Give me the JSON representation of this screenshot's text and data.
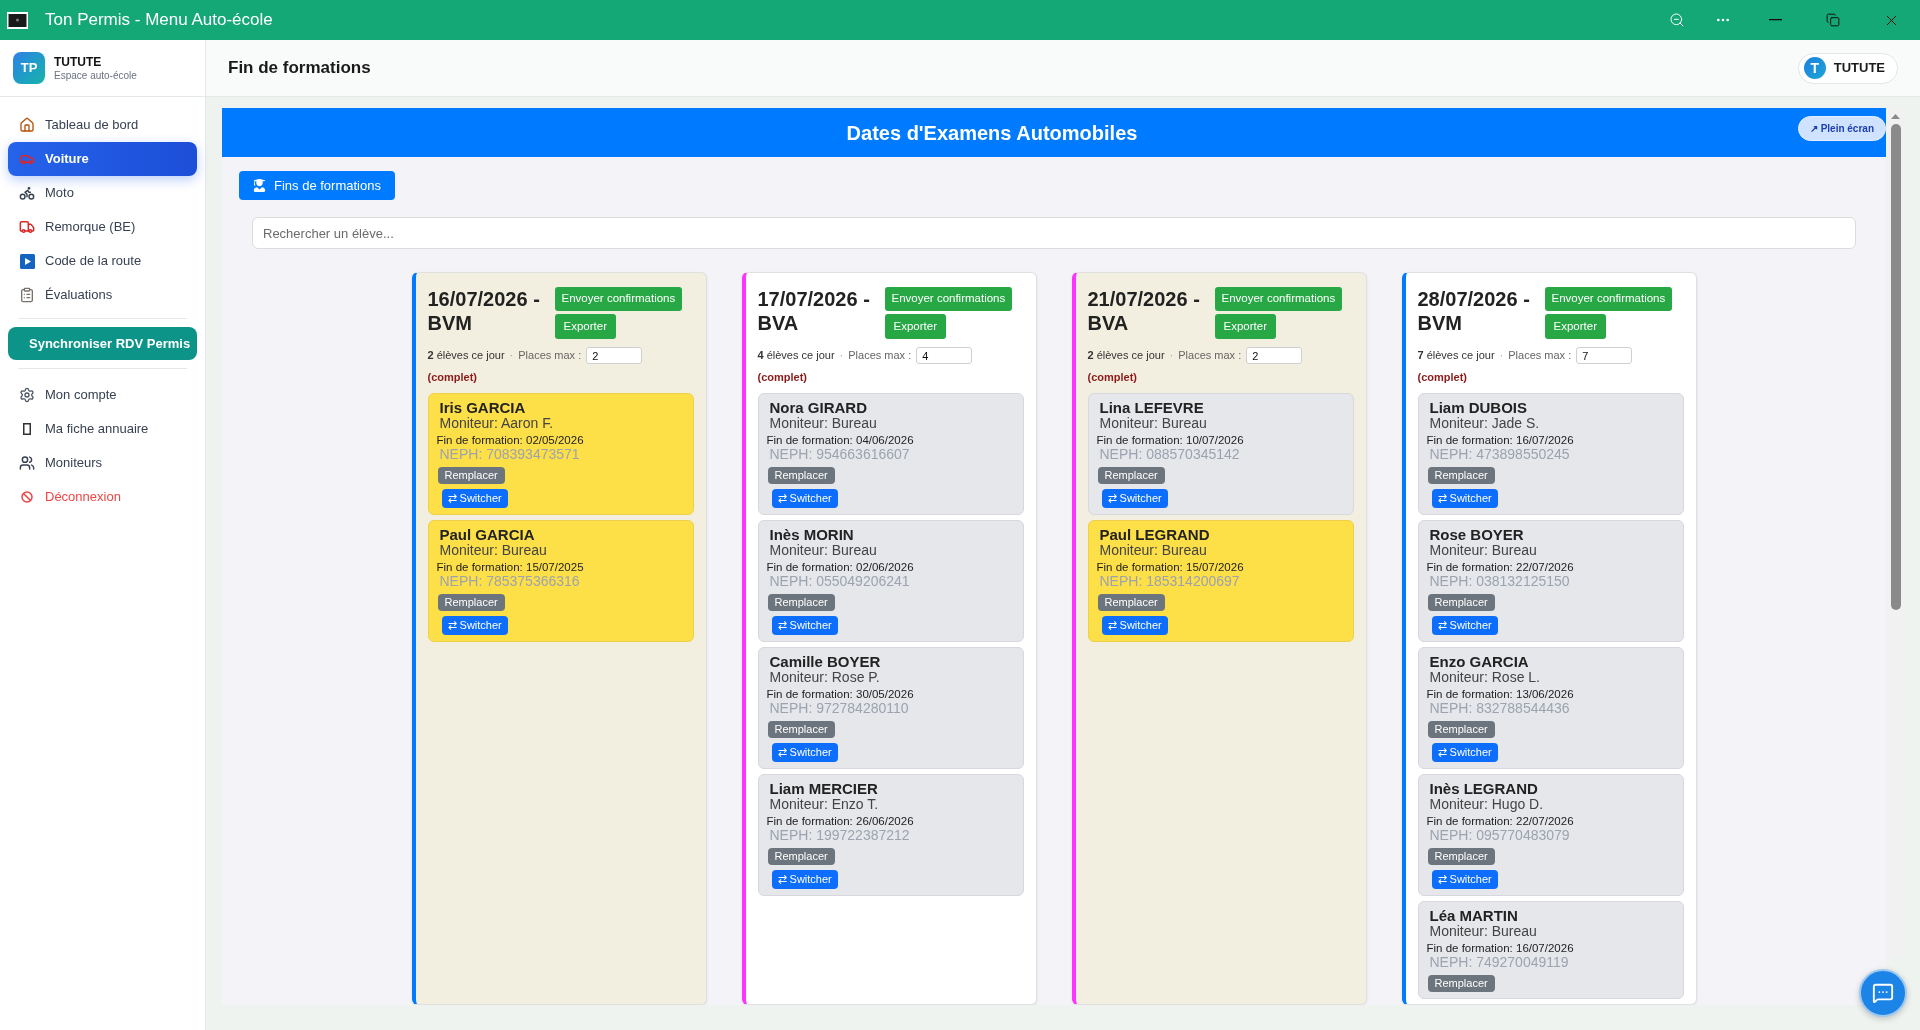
{
  "window": {
    "title": "Ton Permis - Menu Auto-école"
  },
  "sidebar": {
    "brand": {
      "logo": "TP",
      "name": "TUTUTE",
      "subtitle": "Espace auto-école"
    },
    "nav_items": [
      {
        "label": "Tableau de bord",
        "selected": false
      },
      {
        "label": "Voiture",
        "selected": true
      },
      {
        "label": "Moto",
        "selected": false
      },
      {
        "label": "Remorque (BE)",
        "selected": false
      },
      {
        "label": "Code de la route",
        "selected": false
      },
      {
        "label": "Évaluations",
        "selected": false
      }
    ],
    "sync_button": {
      "label": "Synchroniser RDV Permis"
    },
    "account_items": [
      {
        "label": "Mon compte",
        "kind": "link",
        "selected": false
      },
      {
        "label": "Ma fiche annuaire",
        "kind": "link",
        "selected": false
      },
      {
        "label": "Moniteurs",
        "kind": "link",
        "selected": false
      },
      {
        "label": "Déconnexion",
        "kind": "danger",
        "selected": false
      }
    ]
  },
  "header": {
    "title": "Fin de formations",
    "user": {
      "initial": "T",
      "name": "TUTUTE"
    }
  },
  "panel": {
    "title": "Dates d'Examens Automobiles",
    "fullscreen_button": "↗ Plein écran",
    "filter_button": "Fins de formations",
    "search": {
      "placeholder": "Rechercher un élève..."
    },
    "columns": [
      {
        "title": "16/07/2026 - BVM",
        "color": "#007bff",
        "confirm_button": "Envoyer confirmations",
        "export_button": "Exporter",
        "count": "**2** élèves ce jour",
        "separator": "·",
        "places_label": "Places max :",
        "places_value": "2",
        "status": "(complet)",
        "students": [
          {
            "name": "Iris GARCIA",
            "monitor": "Moniteur: Aaron F.",
            "end_date": "Fin de formation: 02/05/2026",
            "neph": "NEPH: 708393473571",
            "highlighted": true,
            "replace_button": "Remplacer",
            "switch_button": "⇄ Switcher"
          },
          {
            "name": "Paul GARCIA",
            "monitor": "Moniteur: Bureau",
            "end_date": "Fin de formation: 15/07/2025",
            "neph": "NEPH: 785375366316",
            "highlighted": true,
            "replace_button": "Remplacer",
            "switch_button": "⇄ Switcher"
          }
        ]
      },
      {
        "title": "17/07/2026 - BVA",
        "color": "#ff33ff",
        "confirm_button": "Envoyer confirmations",
        "export_button": "Exporter",
        "count": "**4** élèves ce jour",
        "separator": "·",
        "places_label": "Places max :",
        "places_value": "4",
        "status": "(complet)",
        "students": [
          {
            "name": "Nora GIRARD",
            "monitor": "Moniteur: Bureau",
            "end_date": "Fin de formation: 04/06/2026",
            "neph": "NEPH: 954663616607",
            "highlighted": false,
            "replace_button": "Remplacer",
            "switch_button": "⇄ Switcher"
          },
          {
            "name": "Inès MORIN",
            "monitor": "Moniteur: Bureau",
            "end_date": "Fin de formation: 02/06/2026",
            "neph": "NEPH: 055049206241",
            "highlighted": false,
            "replace_button": "Remplacer",
            "switch_button": "⇄ Switcher"
          },
          {
            "name": "Camille BOYER",
            "monitor": "Moniteur: Rose P.",
            "end_date": "Fin de formation: 30/05/2026",
            "neph": "NEPH: 972784280110",
            "highlighted": false,
            "replace_button": "Remplacer",
            "switch_button": "⇄ Switcher"
          },
          {
            "name": "Liam MERCIER",
            "monitor": "Moniteur: Enzo T.",
            "end_date": "Fin de formation: 26/06/2026",
            "neph": "NEPH: 199722387212",
            "highlighted": false,
            "replace_button": "Remplacer",
            "switch_button": "⇄ Switcher"
          }
        ]
      },
      {
        "title": "21/07/2026 - BVA",
        "color": "#ff33ff",
        "confirm_button": "Envoyer confirmations",
        "export_button": "Exporter",
        "count": "**2** élèves ce jour",
        "separator": "·",
        "places_label": "Places max :",
        "places_value": "2",
        "status": "(complet)",
        "students": [
          {
            "name": "Lina LEFEVRE",
            "monitor": "Moniteur: Bureau",
            "end_date": "Fin de formation: 10/07/2026",
            "neph": "NEPH: 088570345142",
            "highlighted": false,
            "replace_button": "Remplacer",
            "switch_button": "⇄ Switcher"
          },
          {
            "name": "Paul LEGRAND",
            "monitor": "Moniteur: Bureau",
            "end_date": "Fin de formation: 15/07/2026",
            "neph": "NEPH: 185314200697",
            "highlighted": true,
            "replace_button": "Remplacer",
            "switch_button": "⇄ Switcher"
          }
        ]
      },
      {
        "title": "28/07/2026 - BVM",
        "color": "#007bff",
        "confirm_button": "Envoyer confirmations",
        "export_button": "Exporter",
        "count": "**7** élèves ce jour",
        "separator": "·",
        "places_label": "Places max :",
        "places_value": "7",
        "status": "(complet)",
        "students": [
          {
            "name": "Liam DUBOIS",
            "monitor": "Moniteur: Jade S.",
            "end_date": "Fin de formation: 16/07/2026",
            "neph": "NEPH: 473898550245",
            "highlighted": false,
            "replace_button": "Remplacer",
            "switch_button": "⇄ Switcher"
          },
          {
            "name": "Rose BOYER",
            "monitor": "Moniteur: Bureau",
            "end_date": "Fin de formation: 22/07/2026",
            "neph": "NEPH: 038132125150",
            "highlighted": false,
            "replace_button": "Remplacer",
            "switch_button": "⇄ Switcher"
          },
          {
            "name": "Enzo GARCIA",
            "monitor": "Moniteur: Rose L.",
            "end_date": "Fin de formation: 13/06/2026",
            "neph": "NEPH: 832788544436",
            "highlighted": false,
            "replace_button": "Remplacer",
            "switch_button": "⇄ Switcher"
          },
          {
            "name": "Inès LEGRAND",
            "monitor": "Moniteur: Hugo D.",
            "end_date": "Fin de formation: 22/07/2026",
            "neph": "NEPH: 095770483079",
            "highlighted": false,
            "replace_button": "Remplacer",
            "switch_button": "⇄ Switcher"
          },
          {
            "name": "Léa MARTIN",
            "monitor": "Moniteur: Bureau",
            "end_date": "Fin de formation: 16/07/2026",
            "neph": "NEPH: 749270049119",
            "highlighted": false,
            "replace_button": "Remplacer"
          }
        ]
      }
    ]
  }
}
